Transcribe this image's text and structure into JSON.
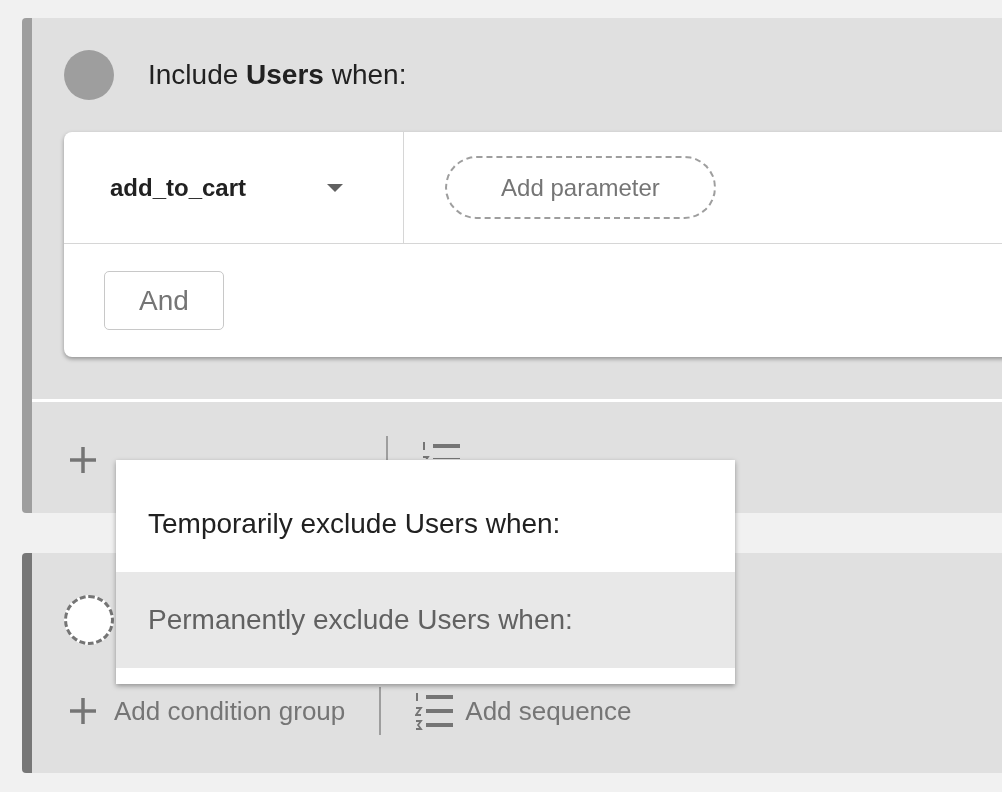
{
  "groups": [
    {
      "kind": "include",
      "header": "Include **Users** when:",
      "filled": true,
      "event": "add_to_cart",
      "add_parameter": "Add parameter",
      "and_button": "And"
    },
    {
      "kind": "exclude",
      "filled": false,
      "add_condition_group": "Add condition group",
      "add_sequence": "Add sequence"
    }
  ],
  "menu": {
    "items": [
      {
        "label": "Temporarily exclude Users when:",
        "selected": false
      },
      {
        "label": "Permanently exclude Users when:",
        "selected": true
      }
    ]
  }
}
